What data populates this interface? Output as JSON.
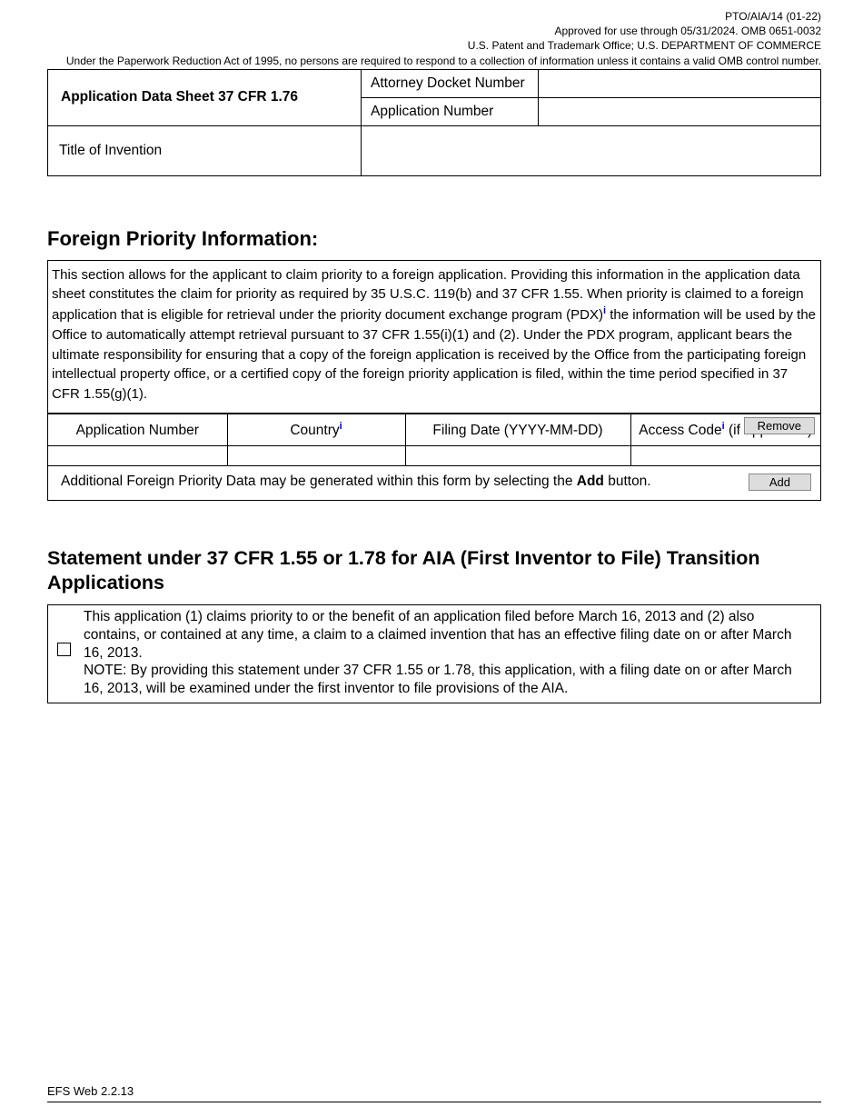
{
  "header": {
    "line1": "PTO/AIA/14 (01-22)",
    "line2": "Approved for use through 05/31/2024.  OMB 0651-0032",
    "line3": "U.S. Patent and Trademark Office; U.S. DEPARTMENT OF COMMERCE",
    "notice": "Under the Paperwork Reduction Act of 1995, no persons are required to respond to a collection of information unless it contains a valid OMB control number."
  },
  "topTable": {
    "adsTitle": "Application Data Sheet 37 CFR 1.76",
    "attorneyDocketLabel": "Attorney Docket Number",
    "attorneyDocketValue": "",
    "appNumberLabel": "Application Number",
    "appNumberValue": "",
    "titleLabel": "Title of Invention",
    "titleValue": ""
  },
  "fpi": {
    "heading": "Foreign Priority Information:",
    "desc_p1": "This section allows for the applicant to claim priority to a foreign application.  Providing this information in the application data sheet constitutes the claim for priority as required by 35 U.S.C. 119(b) and 37 CFR 1.55.  When priority is claimed to a foreign application that is eligible for retrieval under the priority document exchange program (PDX)",
    "desc_p2": " the information will be used by the Office to automatically attempt retrieval pursuant to 37 CFR 1.55(i)(1) and (2).  Under the PDX program, applicant bears the ultimate responsibility for ensuring that a copy of the foreign application is received by the Office from the participating foreign intellectual property office, or a certified copy of the foreign priority application is filed, within the time period specified in 37 CFR 1.55(g)(1).",
    "columns": {
      "appNumber": "Application Number",
      "country": "Country",
      "filingDate": "Filing Date (YYYY-MM-DD)",
      "accessCode_a": "Access Code",
      "accessCode_b": "(if applicable)"
    },
    "removeLabel": "Remove",
    "addText_a": "Additional Foreign Priority Data may be generated within this form by selecting the ",
    "addText_b": "Add",
    "addText_c": " button.",
    "addLabel": "Add",
    "row": {
      "appNumber": "",
      "country": "",
      "filingDate": "",
      "accessCode": ""
    }
  },
  "stmt": {
    "heading": "Statement under 37 CFR 1.55 or 1.78 for AIA (First Inventor to File) Transition Applications",
    "text_a": "This application (1) claims priority to or the benefit of an application filed before March 16, 2013 and (2) also contains, or contained at any time, a claim to a claimed invention that has an effective filing date on or after March 16, 2013.",
    "text_b": "NOTE: By providing this statement under 37 CFR 1.55 or 1.78, this application, with a filing date on or after March 16, 2013, will be examined under the first inventor to file provisions of the AIA."
  },
  "footer": "EFS Web 2.2.13",
  "sup_i": "i"
}
